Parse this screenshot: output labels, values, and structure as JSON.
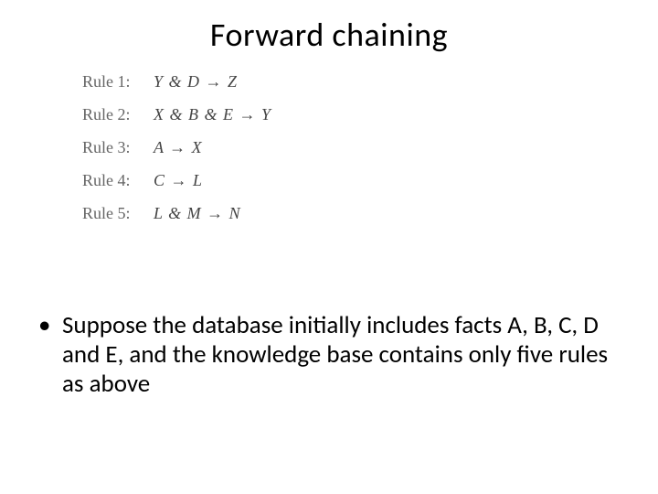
{
  "title": "Forward chaining",
  "rules": [
    {
      "label": "Rule 1:",
      "body": "Y & D → Z"
    },
    {
      "label": "Rule 2:",
      "body": "X & B & E → Y"
    },
    {
      "label": "Rule 3:",
      "body": "A → X"
    },
    {
      "label": "Rule 4:",
      "body": "C → L"
    },
    {
      "label": "Rule 5:",
      "body": "L & M → N"
    }
  ],
  "bullet": {
    "marker": "•",
    "text": "Suppose the database initially includes facts A, B, C, D and E, and the knowledge base contains only five rules as above"
  }
}
